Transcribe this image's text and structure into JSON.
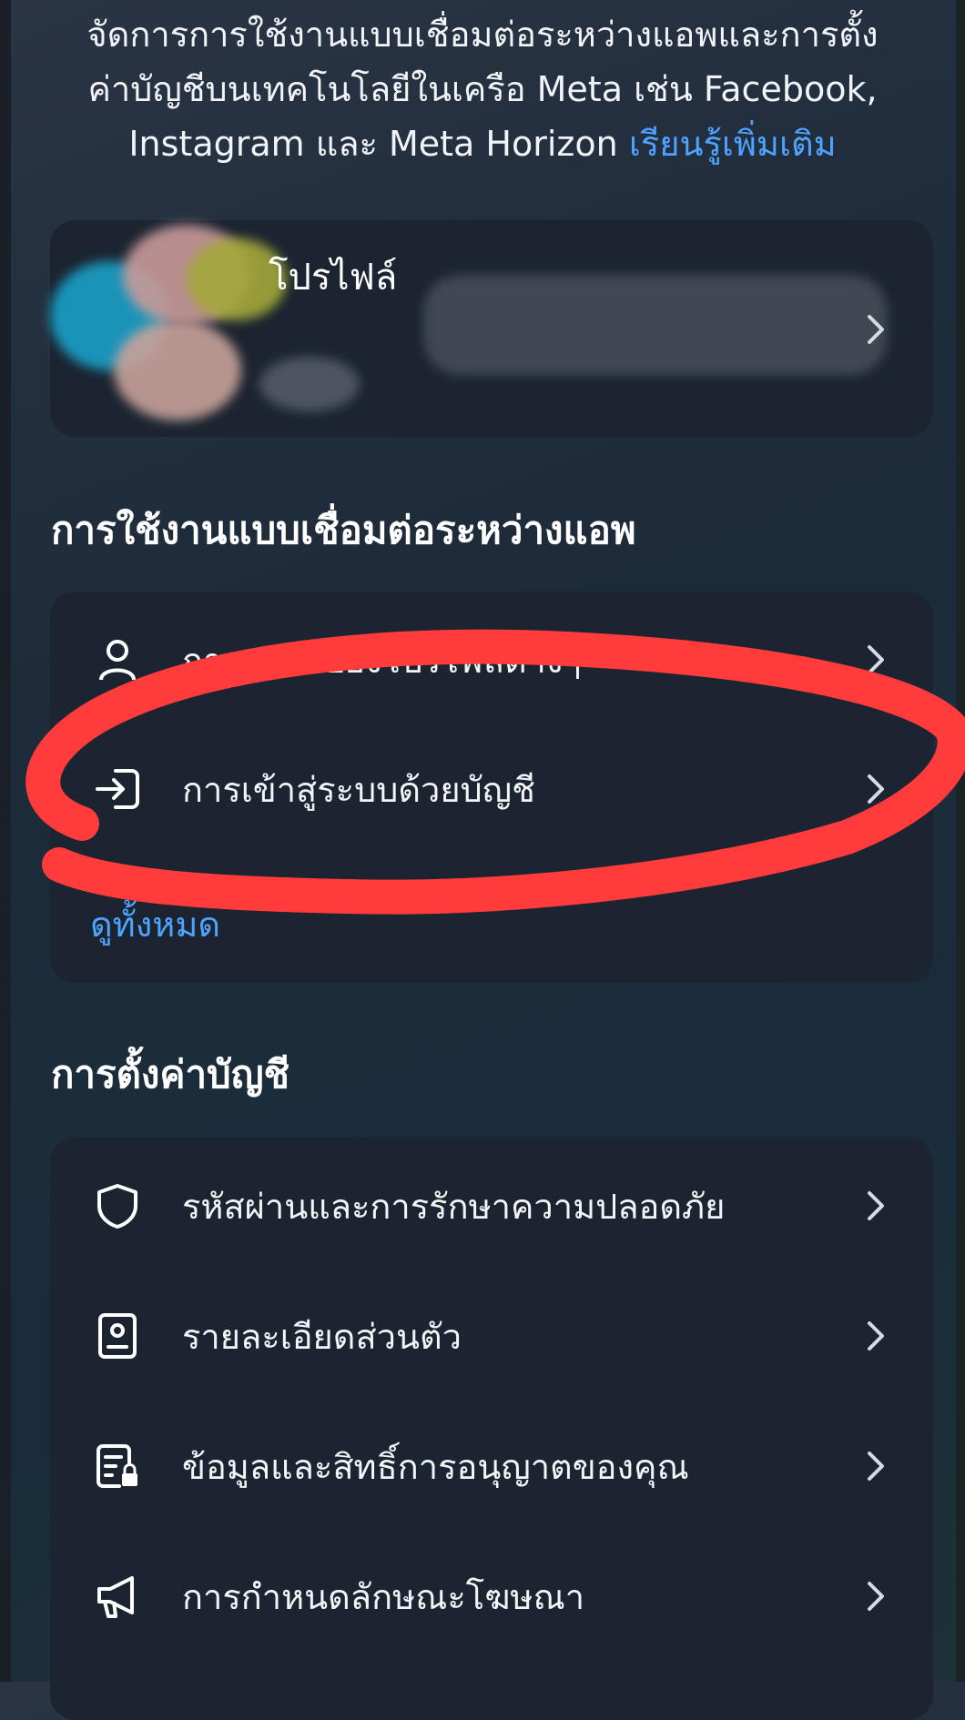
{
  "intro": {
    "line1": "จัดการการใช้งานแบบเชื่อมต่อระหว่างแอพและการตั้ง",
    "line2": "ค่าบัญชีบนเทคโนโลยีในเครือ Meta เช่น Facebook,",
    "line3": "Instagram และ Meta Horizon",
    "learn_more": "เรียนรู้เพิ่มเติม"
  },
  "profile_card": {
    "label": "โปรไฟล์"
  },
  "connected": {
    "title": "การใช้งานแบบเชื่อมต่อระหว่างแอพ",
    "items": [
      {
        "label": "การแชร์ไปยังโปรไฟล์ต่างๆ",
        "icon": "person-icon"
      },
      {
        "label": "การเข้าสู่ระบบด้วยบัญชี",
        "icon": "login-arrow-icon"
      }
    ],
    "see_all": "ดูทั้งหมด"
  },
  "account_settings": {
    "title": "การตั้งค่าบัญชี",
    "items": [
      {
        "label": "รหัสผ่านและการรักษาความปลอดภัย",
        "icon": "shield-icon"
      },
      {
        "label": "รายละเอียดส่วนตัว",
        "icon": "id-card-icon"
      },
      {
        "label": "ข้อมูลและสิทธิ์การอนุญาตของคุณ",
        "icon": "document-lock-icon"
      },
      {
        "label": "การกำหนดลักษณะโฆษณา",
        "icon": "megaphone-icon"
      }
    ]
  },
  "colors": {
    "background": "#1d2b3a",
    "card": "#1b2430",
    "link": "#4ea3ff",
    "annotation": "#ff3b3b"
  }
}
